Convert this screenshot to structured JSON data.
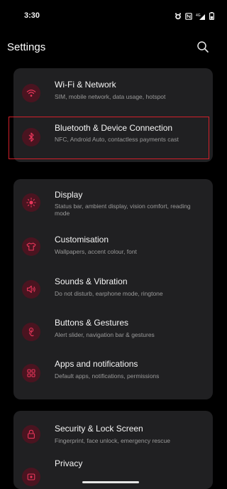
{
  "status_bar": {
    "time": "3:30",
    "icons": [
      "alarm-icon",
      "nfc-icon",
      "signal-4g-icon",
      "battery-icon"
    ]
  },
  "header": {
    "title": "Settings",
    "search_icon": "search-icon"
  },
  "colors": {
    "background": "#000000",
    "card": "#202022",
    "icon_bg": "#4a1420",
    "accent": "#e8365a",
    "highlight": "#d11f2a"
  },
  "items": [
    {
      "title": "Wi-Fi & Network",
      "subtitle": "SIM, mobile network, data usage, hotspot",
      "icon": "wifi-icon"
    },
    {
      "title": "Bluetooth & Device Connection",
      "subtitle": "NFC, Android Auto, contactless payments cast",
      "icon": "bluetooth-icon"
    },
    {
      "title": "Display",
      "subtitle": "Status bar, ambient display, vision comfort, reading mode",
      "icon": "display-icon"
    },
    {
      "title": "Customisation",
      "subtitle": "Wallpapers, accent colour, font",
      "icon": "customisation-icon"
    },
    {
      "title": "Sounds & Vibration",
      "subtitle": "Do not disturb, earphone mode, ringtone",
      "icon": "sound-icon"
    },
    {
      "title": "Buttons & Gestures",
      "subtitle": "Alert slider, navigation bar & gestures",
      "icon": "gestures-icon"
    },
    {
      "title": "Apps and notifications",
      "subtitle": "Default apps, notifications, permissions",
      "icon": "apps-icon"
    },
    {
      "title": "Security & Lock Screen",
      "subtitle": "Fingerprint, face unlock, emergency rescue",
      "icon": "lock-icon"
    },
    {
      "title": "Privacy",
      "subtitle": "",
      "icon": "privacy-icon"
    }
  ]
}
